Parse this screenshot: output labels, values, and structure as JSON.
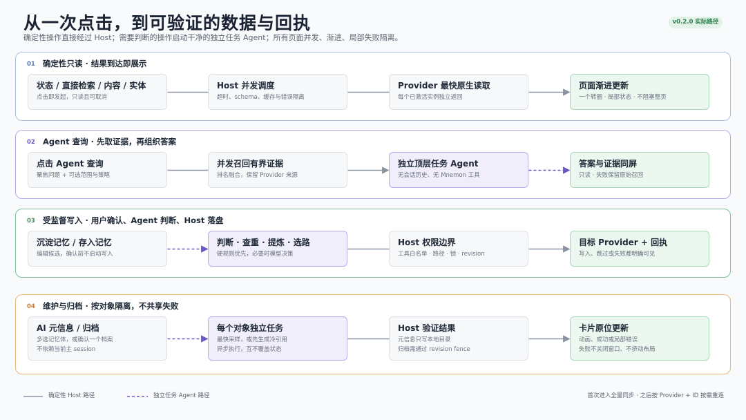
{
  "header": {
    "title": "从一次点击，到可验证的数据与回执",
    "subtitle": "确定性操作直接经过 Host；需要判断的操作启动干净的独立任务 Agent；所有页面并发、渐进、局部失败隔离。",
    "version_badge": "v0.2.0 实际路径"
  },
  "colors": {
    "host_line": "#8a93a0",
    "agent_line": "#6b58c2",
    "section1_border": "#a9c2e3",
    "section2_border": "#b6a8e3",
    "section3_border": "#7cbf95",
    "section4_border": "#ebb77a",
    "agent_box": "#f1eefc",
    "result_box": "#ebf7ef"
  },
  "sections": [
    {
      "number": "01",
      "title": "确定性只读 · 结果到达即展示",
      "boxes": [
        {
          "title": "状态 / 直接检索 / 内容 / 实体",
          "desc": "点击即发起，只读且可取消"
        },
        {
          "title": "Host 并发调度",
          "desc": "超时、schema、缓存与错误隔离"
        },
        {
          "title": "Provider 最快原生读取",
          "desc": "每个已激活实例独立返回"
        },
        {
          "title": "页面渐进更新",
          "desc": "一个转圈 · 局部状态 · 不阻塞整页"
        }
      ],
      "connectors": [
        "solid",
        "solid",
        "solid-arrow"
      ]
    },
    {
      "number": "02",
      "title": "Agent 查询 · 先取证据，再组织答案",
      "boxes": [
        {
          "title": "点击 Agent 查询",
          "desc": "聚焦问题 + 可选范围与策略"
        },
        {
          "title": "并发召回有界证据",
          "desc": "排名融合，保留 Provider 来源"
        },
        {
          "title": "独立顶层任务 Agent",
          "desc": "无会话历史、无 Mnemon 工具"
        },
        {
          "title": "答案与证据同屏",
          "desc": "只读 · 失败保留原始召回"
        }
      ],
      "connectors": [
        "solid",
        "solid-arrow",
        "dashed-arrow"
      ]
    },
    {
      "number": "03",
      "title": "受监督写入 · 用户确认、Agent 判断、Host 落盘",
      "boxes": [
        {
          "title": "沉淀记忆 / 存入记忆",
          "desc": "编辑候选，确认前不启动写入"
        },
        {
          "title": "判断 · 查重 · 提炼 · 选路",
          "desc": "硬规则优先，必要时模型决策"
        },
        {
          "title": "Host 权限边界",
          "desc": "工具白名单 · 路径 · 锁 · revision"
        },
        {
          "title": "目标 Provider + 回执",
          "desc": "写入、跳过或失败都明确可见"
        }
      ],
      "connectors": [
        "dashed-arrow",
        "solid",
        "solid-arrow"
      ]
    },
    {
      "number": "04",
      "title": "维护与归档 · 按对象隔离，不共享失败",
      "boxes": [
        {
          "title": "AI 元信息 / 归档",
          "desc": "多选记忆体，或确认一个档案",
          "desc2": "不依赖当前主 session"
        },
        {
          "title": "每个对象独立任务",
          "desc": "最快采样，或先生成冷引用",
          "desc2": "异步执行，互不覆盖状态"
        },
        {
          "title": "Host 验证结果",
          "desc": "元信息只写本地目录",
          "desc2": "归档需通过 revision fence"
        },
        {
          "title": "卡片原位更新",
          "desc": "动画、成功或局部错误",
          "desc2": "失败不关闭窗口、不挤动布局"
        }
      ],
      "connectors": [
        "dashed-arrow",
        "solid",
        "solid-arrow"
      ]
    }
  ],
  "legend": {
    "host_path": "确定性 Host 路径",
    "agent_path": "独立任务 Agent 路径"
  },
  "footer_note": "首次进入全量同步 · 之后按 Provider + ID 按需重连"
}
